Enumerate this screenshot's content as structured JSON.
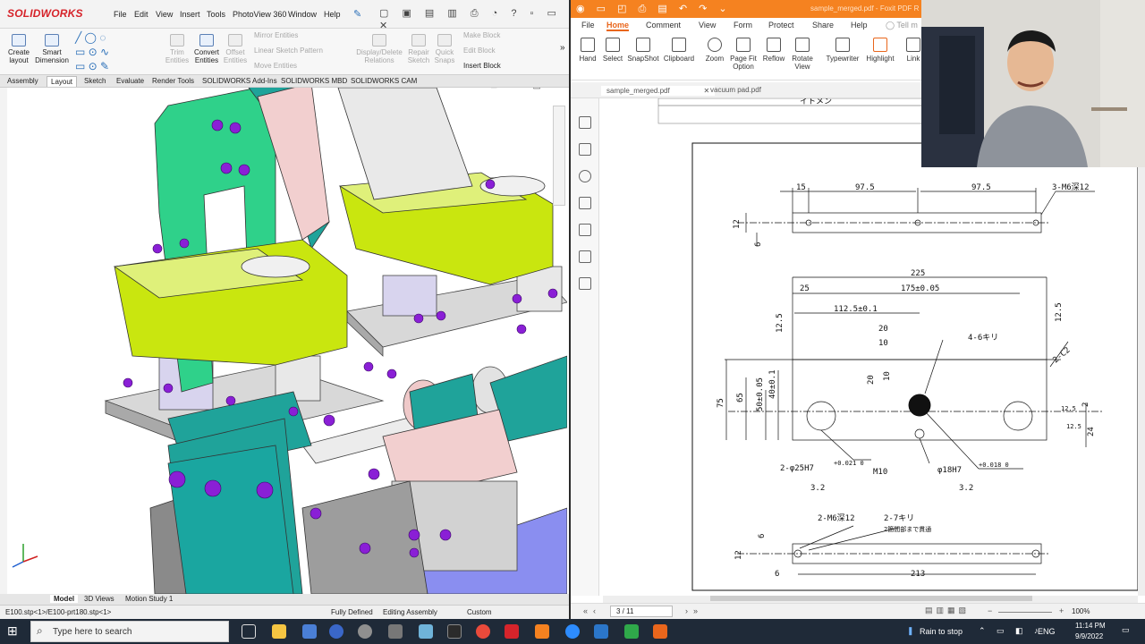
{
  "solidworks": {
    "logo": "SOLIDWORKS",
    "menu": [
      "File",
      "Edit",
      "View",
      "Insert",
      "Tools",
      "PhotoView 360",
      "Window",
      "Help"
    ],
    "ribbon": {
      "create_layout": "Create layout",
      "smart_dimension": "Smart Dimension",
      "trim_entities": "Trim Entities",
      "convert_entities": "Convert Entities",
      "offset_entities": "Offset Entities",
      "mirror_entities": "Mirror Entities",
      "linear_sketch_pattern": "Linear Sketch Pattern",
      "move_entities": "Move Entities",
      "display_delete_relations": "Display/Delete Relations",
      "repair_sketch": "Repair Sketch",
      "quick_snaps": "Quick Snaps",
      "make_block": "Make Block",
      "edit_block": "Edit Block",
      "insert_block": "Insert Block"
    },
    "tabs": [
      "Assembly",
      "Layout",
      "Sketch",
      "Evaluate",
      "Render Tools",
      "SOLIDWORKS Add-Ins",
      "SOLIDWORKS MBD",
      "SOLIDWORKS CAM"
    ],
    "active_tab": "Layout",
    "bottom_tabs": [
      "Model",
      "3D Views",
      "Motion Study 1"
    ],
    "status": {
      "path": "E100.stp<1>/E100-prt180.stp<1>",
      "defined": "Fully Defined",
      "mode": "Editing Assembly",
      "units": "Custom"
    }
  },
  "foxit": {
    "title": "sample_merged.pdf - Foxit PDF R",
    "tabs": [
      "File",
      "Home",
      "Comment",
      "View",
      "Form",
      "Protect",
      "Share",
      "Help"
    ],
    "active_tab": "Home",
    "tell_me": "Tell m",
    "tools": {
      "hand": "Hand",
      "select": "Select",
      "snapshot": "SnapShot",
      "clipboard": "Clipboard",
      "zoom": "Zoom",
      "page_fit": "Page Fit Option",
      "reflow": "Reflow",
      "rotate": "Rotate View",
      "typewriter": "Typewriter",
      "highlight": "Highlight",
      "link": "Link"
    },
    "doc_tabs": [
      "sample_merged.pdf",
      "vacuum pad.pdf"
    ],
    "page_indicator": "3 / 11",
    "zoom": "100%",
    "drawing": {
      "top_header": "イトメン",
      "top_dims": [
        "15",
        "97.5",
        "97.5"
      ],
      "top_note": "3-M6深12",
      "top_side": [
        "12",
        "6"
      ],
      "mid_width": "225",
      "mid_25": "25",
      "mid_175": "175±0.05",
      "mid_1125": "112.5±0.1",
      "mid_20": "20",
      "mid_10": "10",
      "mid_holes": "4-6キリ",
      "mid_c2": "2-C2",
      "mid_125a": "12.5",
      "mid_125b": "12.5",
      "mid_height": "75",
      "mid_65": "65",
      "mid_50": "50±0.05",
      "mid_40": "40±0.1",
      "mid_v20": "20",
      "mid_v10": "10",
      "mid_2": "2",
      "mid_24": "24",
      "mid_125c": "12.5",
      "mid_125d": "12.5",
      "mid_bore1": "2-φ25H7",
      "mid_bore1_tol": "+0.021 0",
      "mid_m10": "M10",
      "mid_bore2": "φ18H7",
      "mid_bore2_tol": "+0.018 0",
      "rough_a": "3.2",
      "rough_b": "3.2",
      "bot_note1": "2-M6深12",
      "bot_note2": "2-7キリ",
      "bot_note3": "2箇間部まで貫通",
      "bot_6a": "6",
      "bot_12": "12",
      "bot_6b": "6",
      "bot_width": "213"
    }
  },
  "taskbar": {
    "search_placeholder": "Type here to search",
    "rain": "Rain to stop",
    "lang": "ENG",
    "time": "11:14 PM",
    "date": "9/9/2022"
  },
  "colors": {
    "foxit_orange": "#f58220",
    "sw_red": "#d6242b",
    "part_green": "#2fd18a",
    "part_yellow": "#c9e60f",
    "part_teal": "#1aa6a0",
    "part_pink": "#f0c8c8",
    "bolt_purple": "#8a1fd6"
  }
}
